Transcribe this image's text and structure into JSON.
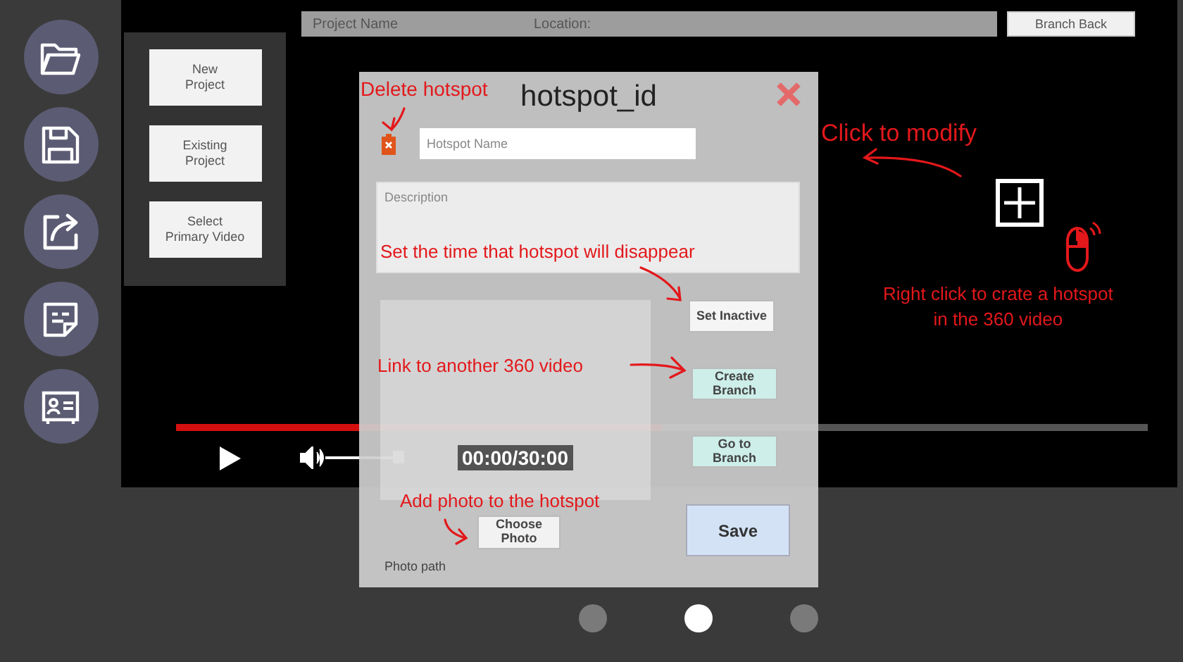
{
  "top_bar": {
    "project_name": "Project Name",
    "location": "Location:",
    "branch_back": "Branch Back"
  },
  "menu": [
    "New\nProject",
    "Existing\nProject",
    "Select\nPrimary Video"
  ],
  "player": {
    "progress": {
      "level": 0.5
    },
    "volume": {
      "level": 1
    },
    "time": "00:00/30:00"
  },
  "pager": [
    {
      "selected": false
    },
    {
      "selected": true
    },
    {
      "selected": false
    }
  ],
  "dialog": {
    "title": "hotspot_id",
    "name_placeholder": "Hotspot Name",
    "description_placeholder": "Description",
    "buttons": [
      {
        "label": "Set Inactive",
        "kind": "plain"
      },
      {
        "label": "Create\nBranch",
        "kind": "branch"
      },
      {
        "label": "Go to\nBranch",
        "kind": "branch"
      }
    ],
    "choose_photo": "Choose\nPhoto",
    "photo_path": "Photo path",
    "save": "Save"
  },
  "annotations": [
    "Delete hotspot",
    "Click to modify",
    "Set the time that hotspot will disappear",
    "Right click to crate a hotspot\nin the 360 video",
    "Link to another 360 video",
    "Add photo to the hotspot"
  ]
}
